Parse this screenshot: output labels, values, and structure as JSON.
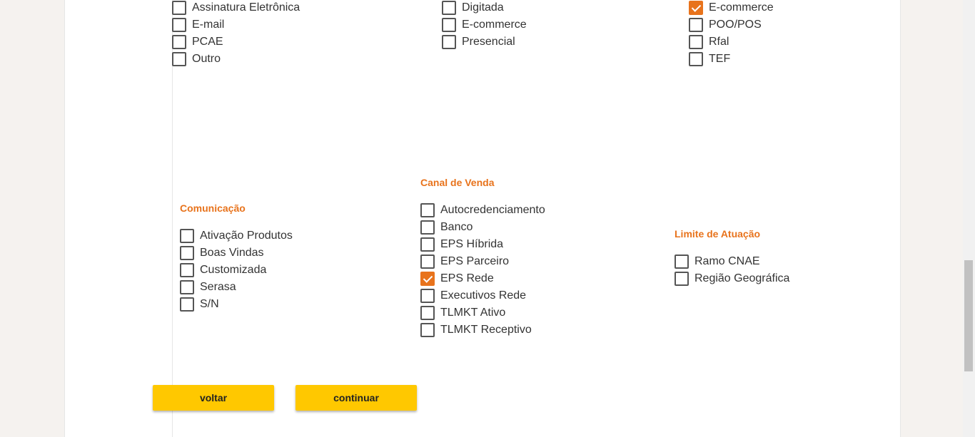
{
  "top_columns": [
    {
      "items": [
        {
          "label": "Assinatura Eletrônica",
          "checked": false
        },
        {
          "label": "E-mail",
          "checked": false
        },
        {
          "label": "PCAE",
          "checked": false
        },
        {
          "label": "Outro",
          "checked": false
        }
      ]
    },
    {
      "items": [
        {
          "label": "Digitada",
          "checked": false
        },
        {
          "label": "E-commerce",
          "checked": false
        },
        {
          "label": "Presencial",
          "checked": false
        }
      ]
    },
    {
      "items": [
        {
          "label": "E-commerce",
          "checked": true
        },
        {
          "label": "POO/POS",
          "checked": false
        },
        {
          "label": "Rfal",
          "checked": false
        },
        {
          "label": "TEF",
          "checked": false
        }
      ]
    }
  ],
  "comunicacao": {
    "title": "Comunicação",
    "items": [
      {
        "label": "Ativação Produtos",
        "checked": false
      },
      {
        "label": "Boas Vindas",
        "checked": false
      },
      {
        "label": "Customizada",
        "checked": false
      },
      {
        "label": "Serasa",
        "checked": false
      },
      {
        "label": "S/N",
        "checked": false
      }
    ]
  },
  "canal_venda": {
    "title": "Canal de Venda",
    "items": [
      {
        "label": "Autocredenciamento",
        "checked": false
      },
      {
        "label": "Banco",
        "checked": false
      },
      {
        "label": "EPS Híbrida",
        "checked": false
      },
      {
        "label": "EPS Parceiro",
        "checked": false
      },
      {
        "label": "EPS Rede",
        "checked": true
      },
      {
        "label": "Executivos Rede",
        "checked": false
      },
      {
        "label": "TLMKT Ativo",
        "checked": false
      },
      {
        "label": "TLMKT Receptivo",
        "checked": false
      }
    ]
  },
  "limite_atuacao": {
    "title": "Limite de Atuação",
    "items": [
      {
        "label": "Ramo CNAE",
        "checked": false
      },
      {
        "label": "Região Geográfica",
        "checked": false
      }
    ]
  },
  "buttons": {
    "back": "voltar",
    "continue": "continuar"
  },
  "colors": {
    "accent": "#e8731c",
    "button": "#ffc800"
  }
}
